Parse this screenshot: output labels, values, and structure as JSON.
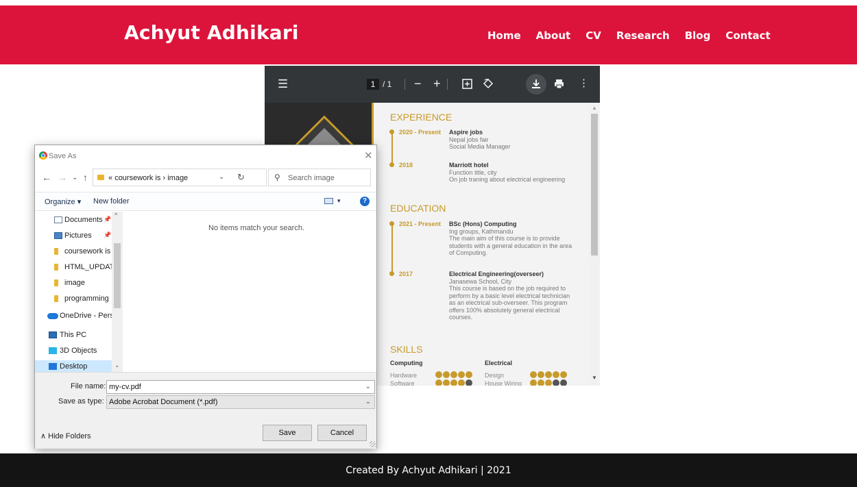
{
  "site": {
    "brand": "Achyut Adhikari",
    "nav": [
      "Home",
      "About",
      "CV",
      "Research",
      "Blog",
      "Contact"
    ],
    "footer": "Created By Achyut Adhikari | 2021",
    "colors": {
      "header": "#dc143c",
      "footer": "#141414",
      "accent": "#c79a2a"
    }
  },
  "pdf_viewer": {
    "page_current": "1",
    "page_total": "/ 1",
    "icons": [
      "menu-icon",
      "zoom-out-icon",
      "zoom-in-icon",
      "fit-page-icon",
      "rotate-icon",
      "download-icon",
      "print-icon",
      "more-icon"
    ],
    "document": {
      "experience": {
        "title": "EXPERIENCE",
        "entries": [
          {
            "date": "2020 - Present",
            "title": "Aspire jobs",
            "line1": "Nepal jobs fair",
            "line2": "Social Media Manager"
          },
          {
            "date": "2018",
            "title": "Marriott hotel",
            "line1": "Function title, city",
            "line2": "On job traning about electrical engineering"
          }
        ]
      },
      "education": {
        "title": "EDUCATION",
        "entries": [
          {
            "date": "2021 - Present",
            "title": "BSc (Hons) Computing",
            "line1": "Ing groups, Kathmandu",
            "line2": "The main aim of this course is to provide students with a general education in the area of Computing."
          },
          {
            "date": "2017",
            "title": "Electrical Engineering(overseer)",
            "line1": "Janasewa School, City",
            "line2": "This course is based on the job required to perform by a basic level electrical technician as an electrical sub-overseer. This program offers 100% absolutely general electrical courses."
          }
        ]
      },
      "skills": {
        "title": "SKILLS",
        "groups": [
          {
            "heading": "Computing",
            "items": [
              {
                "name": "Hardware",
                "level": 5
              },
              {
                "name": "Software",
                "level": 4
              }
            ]
          },
          {
            "heading": "Electrical",
            "items": [
              {
                "name": "Design",
                "level": 5
              },
              {
                "name": "House Wiring",
                "level": 3
              }
            ]
          }
        ]
      }
    }
  },
  "save_dialog": {
    "title": "Save As",
    "path_prefix": "«",
    "path": [
      "coursework is",
      "image"
    ],
    "search_placeholder": "Search image",
    "organize": "Organize ▾",
    "new_folder": "New folder",
    "tree": [
      "Documents",
      "Pictures",
      "coursework is",
      "HTML_UPDATE",
      "image",
      "programming",
      "OneDrive - Person",
      "This PC",
      "3D Objects",
      "Desktop"
    ],
    "empty_message": "No items match your search.",
    "file_name_label": "File name:",
    "file_name_value": "my-cv.pdf",
    "save_type_label": "Save as type:",
    "save_type_value": "Adobe Acrobat Document (*.pdf)",
    "hide_folders": "Hide Folders",
    "save_button": "Save",
    "cancel_button": "Cancel"
  }
}
